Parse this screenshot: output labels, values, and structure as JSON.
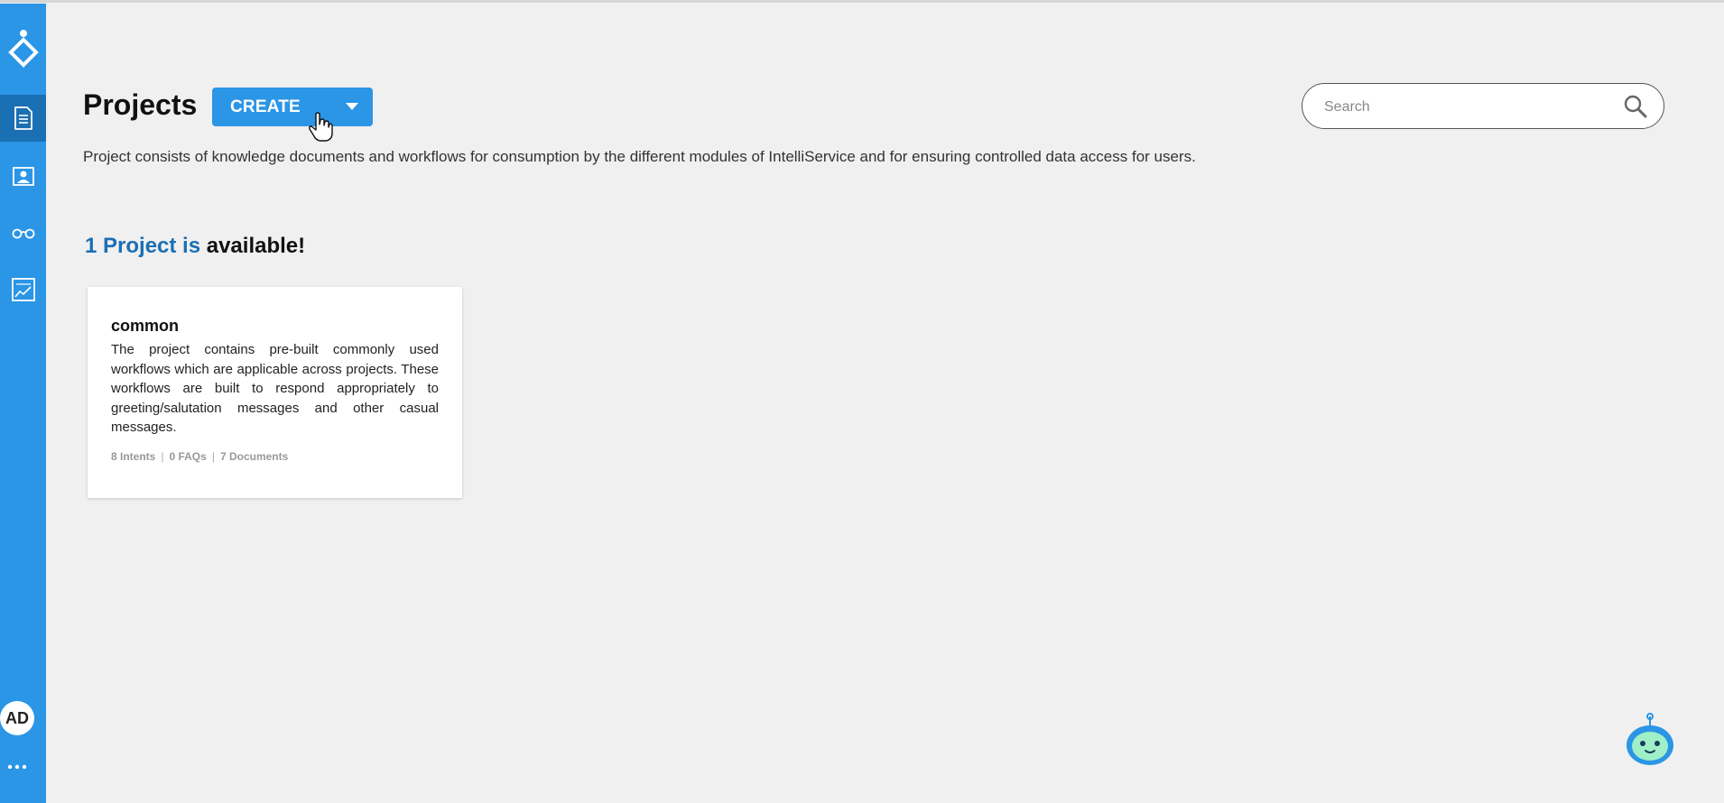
{
  "sidebar": {
    "nav_items": [
      {
        "icon": "document-icon",
        "active": true
      },
      {
        "icon": "profile-card-icon",
        "active": false
      },
      {
        "icon": "glasses-icon",
        "active": false
      },
      {
        "icon": "analytics-chart-icon",
        "active": false
      }
    ],
    "avatar_initials": "AD",
    "more_icon": "more-dots-icon"
  },
  "header": {
    "title": "Projects",
    "create_label": "CREATE",
    "description": "Project consists of knowledge documents and workflows for consumption by the different modules of IntelliService and for ensuring controlled data access for users."
  },
  "search": {
    "placeholder": "Search",
    "value": ""
  },
  "summary": {
    "count_text": "1 Project is",
    "suffix_text": "available!"
  },
  "projects": [
    {
      "name": "common",
      "description": "The project contains pre-built commonly used workflows which are applicable across projects. These workflows are built to respond appropriately to greeting/salutation messages and other casual messages.",
      "intents": "8 Intents",
      "faqs": "0 FAQs",
      "documents": "7 Documents",
      "separator": "|"
    }
  ],
  "colors": {
    "sidebar": "#2b95e6",
    "sidebar_active": "#1b6fb3",
    "accent_text": "#1b6fb3",
    "background": "#f0f0f0"
  }
}
